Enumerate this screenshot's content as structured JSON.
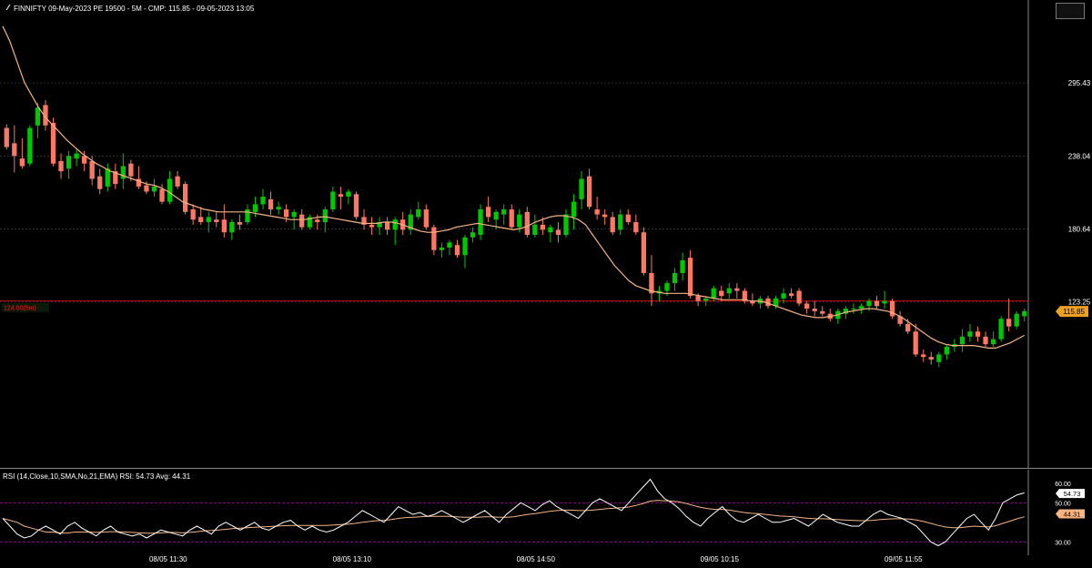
{
  "header": {
    "title": "FINNIFTY 09-May-2023 PE 19500 - 5M -  CMP: 115.85 - 09-05-2023 13:05"
  },
  "rsi_header": {
    "title": "RSI (14,Close,10,SMA,No,21,EMA) RSI: 54.73 Avg: 44.31"
  },
  "colors": {
    "bull": "#00c800",
    "bear": "#fa7864",
    "ma": "#f5b482",
    "rsi": "#ffffff",
    "rsi_avg": "#f5b482",
    "level": "#c80000",
    "band": "#c800c8",
    "cmp": "#f0a020"
  },
  "chart_data": {
    "type": "candlestick",
    "title": "FINNIFTY 09-May-2023 PE 19500 - 5M -  CMP: 115.85 - 09-05-2023 13:05",
    "price_axis": {
      "range": [
        0,
        352
      ],
      "ticks": [
        123.25,
        180.64,
        238.04,
        295.43
      ]
    },
    "cmp": {
      "value": 115.85,
      "label": "115.85"
    },
    "level": {
      "value": 124.0,
      "label": "124.00(5m)"
    },
    "time_labels": [
      {
        "label": "08/05 11:30",
        "index": 18
      },
      {
        "label": "08/05 13:10",
        "index": 38
      },
      {
        "label": "08/05 14:50",
        "index": 58
      },
      {
        "label": "09/05 10:15",
        "index": 78
      },
      {
        "label": "09/05 11:55",
        "index": 98
      }
    ],
    "candles": [
      {
        "o": 260,
        "h": 263,
        "l": 243,
        "c": 245
      },
      {
        "o": 248,
        "h": 262,
        "l": 225,
        "c": 238
      },
      {
        "o": 236,
        "h": 252,
        "l": 228,
        "c": 230
      },
      {
        "o": 232,
        "h": 262,
        "l": 230,
        "c": 260
      },
      {
        "o": 262,
        "h": 280,
        "l": 252,
        "c": 276
      },
      {
        "o": 278,
        "h": 282,
        "l": 258,
        "c": 262
      },
      {
        "o": 264,
        "h": 268,
        "l": 230,
        "c": 232
      },
      {
        "o": 234,
        "h": 240,
        "l": 220,
        "c": 226
      },
      {
        "o": 228,
        "h": 242,
        "l": 220,
        "c": 238
      },
      {
        "o": 236,
        "h": 243,
        "l": 230,
        "c": 240
      },
      {
        "o": 238,
        "h": 242,
        "l": 226,
        "c": 232
      },
      {
        "o": 234,
        "h": 238,
        "l": 215,
        "c": 220
      },
      {
        "o": 222,
        "h": 228,
        "l": 208,
        "c": 212
      },
      {
        "o": 214,
        "h": 232,
        "l": 210,
        "c": 228
      },
      {
        "o": 226,
        "h": 232,
        "l": 212,
        "c": 216
      },
      {
        "o": 220,
        "h": 240,
        "l": 212,
        "c": 230
      },
      {
        "o": 232,
        "h": 235,
        "l": 218,
        "c": 222
      },
      {
        "o": 220,
        "h": 230,
        "l": 212,
        "c": 214
      },
      {
        "o": 215,
        "h": 218,
        "l": 208,
        "c": 210
      },
      {
        "o": 210,
        "h": 220,
        "l": 206,
        "c": 214
      },
      {
        "o": 212,
        "h": 216,
        "l": 200,
        "c": 202
      },
      {
        "o": 202,
        "h": 226,
        "l": 200,
        "c": 220
      },
      {
        "o": 222,
        "h": 226,
        "l": 212,
        "c": 214
      },
      {
        "o": 216,
        "h": 218,
        "l": 192,
        "c": 194
      },
      {
        "o": 196,
        "h": 200,
        "l": 184,
        "c": 188
      },
      {
        "o": 190,
        "h": 198,
        "l": 184,
        "c": 186
      },
      {
        "o": 186,
        "h": 194,
        "l": 178,
        "c": 190
      },
      {
        "o": 188,
        "h": 194,
        "l": 182,
        "c": 186
      },
      {
        "o": 188,
        "h": 200,
        "l": 174,
        "c": 178
      },
      {
        "o": 178,
        "h": 188,
        "l": 172,
        "c": 186
      },
      {
        "o": 186,
        "h": 192,
        "l": 180,
        "c": 184
      },
      {
        "o": 186,
        "h": 200,
        "l": 184,
        "c": 196
      },
      {
        "o": 194,
        "h": 206,
        "l": 190,
        "c": 200
      },
      {
        "o": 200,
        "h": 212,
        "l": 196,
        "c": 206
      },
      {
        "o": 204,
        "h": 210,
        "l": 192,
        "c": 196
      },
      {
        "o": 196,
        "h": 202,
        "l": 192,
        "c": 198
      },
      {
        "o": 196,
        "h": 200,
        "l": 186,
        "c": 190
      },
      {
        "o": 190,
        "h": 196,
        "l": 180,
        "c": 194
      },
      {
        "o": 192,
        "h": 196,
        "l": 180,
        "c": 182
      },
      {
        "o": 182,
        "h": 192,
        "l": 180,
        "c": 190
      },
      {
        "o": 188,
        "h": 192,
        "l": 180,
        "c": 186
      },
      {
        "o": 186,
        "h": 198,
        "l": 178,
        "c": 196
      },
      {
        "o": 196,
        "h": 214,
        "l": 194,
        "c": 210
      },
      {
        "o": 208,
        "h": 214,
        "l": 196,
        "c": 206
      },
      {
        "o": 206,
        "h": 212,
        "l": 200,
        "c": 210
      },
      {
        "o": 208,
        "h": 210,
        "l": 188,
        "c": 190
      },
      {
        "o": 190,
        "h": 196,
        "l": 180,
        "c": 184
      },
      {
        "o": 184,
        "h": 190,
        "l": 176,
        "c": 182
      },
      {
        "o": 182,
        "h": 190,
        "l": 176,
        "c": 186
      },
      {
        "o": 186,
        "h": 190,
        "l": 176,
        "c": 180
      },
      {
        "o": 180,
        "h": 190,
        "l": 168,
        "c": 188
      },
      {
        "o": 188,
        "h": 194,
        "l": 176,
        "c": 180
      },
      {
        "o": 180,
        "h": 196,
        "l": 176,
        "c": 192
      },
      {
        "o": 190,
        "h": 202,
        "l": 188,
        "c": 196
      },
      {
        "o": 196,
        "h": 200,
        "l": 180,
        "c": 182
      },
      {
        "o": 182,
        "h": 184,
        "l": 160,
        "c": 164
      },
      {
        "o": 164,
        "h": 170,
        "l": 158,
        "c": 166
      },
      {
        "o": 166,
        "h": 172,
        "l": 160,
        "c": 170
      },
      {
        "o": 168,
        "h": 172,
        "l": 158,
        "c": 160
      },
      {
        "o": 160,
        "h": 176,
        "l": 150,
        "c": 174
      },
      {
        "o": 174,
        "h": 182,
        "l": 170,
        "c": 178
      },
      {
        "o": 176,
        "h": 200,
        "l": 172,
        "c": 196
      },
      {
        "o": 198,
        "h": 206,
        "l": 186,
        "c": 190
      },
      {
        "o": 188,
        "h": 196,
        "l": 180,
        "c": 194
      },
      {
        "o": 192,
        "h": 200,
        "l": 184,
        "c": 196
      },
      {
        "o": 196,
        "h": 200,
        "l": 180,
        "c": 182
      },
      {
        "o": 182,
        "h": 196,
        "l": 178,
        "c": 192
      },
      {
        "o": 194,
        "h": 198,
        "l": 174,
        "c": 176
      },
      {
        "o": 176,
        "h": 192,
        "l": 174,
        "c": 184
      },
      {
        "o": 184,
        "h": 190,
        "l": 176,
        "c": 180
      },
      {
        "o": 178,
        "h": 184,
        "l": 170,
        "c": 182
      },
      {
        "o": 180,
        "h": 186,
        "l": 170,
        "c": 176
      },
      {
        "o": 176,
        "h": 196,
        "l": 174,
        "c": 192
      },
      {
        "o": 190,
        "h": 208,
        "l": 180,
        "c": 202
      },
      {
        "o": 204,
        "h": 226,
        "l": 196,
        "c": 220
      },
      {
        "o": 222,
        "h": 228,
        "l": 196,
        "c": 198
      },
      {
        "o": 196,
        "h": 206,
        "l": 188,
        "c": 192
      },
      {
        "o": 192,
        "h": 196,
        "l": 184,
        "c": 190
      },
      {
        "o": 190,
        "h": 194,
        "l": 176,
        "c": 178
      },
      {
        "o": 180,
        "h": 196,
        "l": 176,
        "c": 192
      },
      {
        "o": 192,
        "h": 196,
        "l": 184,
        "c": 186
      },
      {
        "o": 186,
        "h": 192,
        "l": 176,
        "c": 178
      },
      {
        "o": 178,
        "h": 182,
        "l": 144,
        "c": 146
      },
      {
        "o": 146,
        "h": 160,
        "l": 120,
        "c": 130
      },
      {
        "o": 130,
        "h": 136,
        "l": 124,
        "c": 132
      },
      {
        "o": 132,
        "h": 140,
        "l": 128,
        "c": 138
      },
      {
        "o": 138,
        "h": 150,
        "l": 132,
        "c": 146
      },
      {
        "o": 146,
        "h": 162,
        "l": 140,
        "c": 156
      },
      {
        "o": 158,
        "h": 164,
        "l": 126,
        "c": 128
      },
      {
        "o": 128,
        "h": 130,
        "l": 120,
        "c": 124
      },
      {
        "o": 124,
        "h": 128,
        "l": 120,
        "c": 126
      },
      {
        "o": 126,
        "h": 136,
        "l": 124,
        "c": 134
      },
      {
        "o": 132,
        "h": 136,
        "l": 124,
        "c": 128
      },
      {
        "o": 130,
        "h": 138,
        "l": 126,
        "c": 134
      },
      {
        "o": 134,
        "h": 138,
        "l": 126,
        "c": 132
      },
      {
        "o": 132,
        "h": 134,
        "l": 122,
        "c": 124
      },
      {
        "o": 124,
        "h": 130,
        "l": 120,
        "c": 122
      },
      {
        "o": 122,
        "h": 128,
        "l": 118,
        "c": 126
      },
      {
        "o": 126,
        "h": 128,
        "l": 118,
        "c": 120
      },
      {
        "o": 120,
        "h": 128,
        "l": 118,
        "c": 126
      },
      {
        "o": 126,
        "h": 134,
        "l": 122,
        "c": 130
      },
      {
        "o": 130,
        "h": 134,
        "l": 126,
        "c": 128
      },
      {
        "o": 132,
        "h": 134,
        "l": 120,
        "c": 122
      },
      {
        "o": 122,
        "h": 124,
        "l": 114,
        "c": 118
      },
      {
        "o": 118,
        "h": 124,
        "l": 112,
        "c": 116
      },
      {
        "o": 116,
        "h": 120,
        "l": 112,
        "c": 114
      },
      {
        "o": 114,
        "h": 118,
        "l": 108,
        "c": 110
      },
      {
        "o": 110,
        "h": 118,
        "l": 106,
        "c": 116
      },
      {
        "o": 114,
        "h": 120,
        "l": 110,
        "c": 118
      },
      {
        "o": 118,
        "h": 122,
        "l": 114,
        "c": 118
      },
      {
        "o": 118,
        "h": 122,
        "l": 114,
        "c": 120
      },
      {
        "o": 120,
        "h": 126,
        "l": 116,
        "c": 124
      },
      {
        "o": 124,
        "h": 128,
        "l": 118,
        "c": 120
      },
      {
        "o": 122,
        "h": 132,
        "l": 118,
        "c": 124
      },
      {
        "o": 124,
        "h": 126,
        "l": 110,
        "c": 112
      },
      {
        "o": 112,
        "h": 116,
        "l": 104,
        "c": 106
      },
      {
        "o": 106,
        "h": 110,
        "l": 98,
        "c": 100
      },
      {
        "o": 100,
        "h": 106,
        "l": 80,
        "c": 82
      },
      {
        "o": 82,
        "h": 86,
        "l": 76,
        "c": 80
      },
      {
        "o": 80,
        "h": 84,
        "l": 74,
        "c": 78
      },
      {
        "o": 76,
        "h": 84,
        "l": 72,
        "c": 82
      },
      {
        "o": 82,
        "h": 90,
        "l": 78,
        "c": 88
      },
      {
        "o": 88,
        "h": 94,
        "l": 84,
        "c": 90
      },
      {
        "o": 90,
        "h": 102,
        "l": 84,
        "c": 96
      },
      {
        "o": 96,
        "h": 106,
        "l": 92,
        "c": 100
      },
      {
        "o": 100,
        "h": 104,
        "l": 92,
        "c": 96
      },
      {
        "o": 96,
        "h": 100,
        "l": 88,
        "c": 90
      },
      {
        "o": 90,
        "h": 100,
        "l": 88,
        "c": 94
      },
      {
        "o": 94,
        "h": 112,
        "l": 92,
        "c": 110
      },
      {
        "o": 110,
        "h": 126,
        "l": 100,
        "c": 104
      },
      {
        "o": 104,
        "h": 116,
        "l": 102,
        "c": 114
      },
      {
        "o": 112,
        "h": 118,
        "l": 108,
        "c": 116
      }
    ],
    "ma_line": [
      340,
      328,
      312,
      296,
      286,
      276,
      268,
      262,
      256,
      250,
      245,
      240,
      236,
      232,
      229,
      226,
      224,
      222,
      220,
      218,
      216,
      215,
      213,
      210,
      206,
      202,
      200,
      198,
      196,
      195,
      194,
      194,
      194,
      194,
      194,
      193,
      192,
      191,
      190,
      189,
      188,
      188,
      188,
      189,
      190,
      190,
      189,
      188,
      187,
      186,
      185,
      185,
      185,
      186,
      186,
      185,
      183,
      181,
      179,
      178,
      178,
      179,
      180,
      182,
      183,
      184,
      185,
      184,
      183,
      182,
      181,
      180,
      181,
      183,
      186,
      188,
      190,
      191,
      191,
      190,
      188,
      184,
      176,
      168,
      160,
      152,
      146,
      140,
      136,
      134,
      132,
      131,
      130,
      130,
      130,
      130,
      129,
      128,
      127,
      126,
      125,
      125,
      125,
      125,
      124,
      124,
      123,
      121,
      119,
      117,
      115,
      113,
      112,
      111,
      111,
      112,
      113,
      115,
      116,
      117,
      118,
      118,
      117,
      116,
      114,
      111,
      107,
      103,
      99,
      95,
      92,
      90,
      89,
      89,
      89,
      89,
      88,
      87,
      87,
      89,
      91,
      94,
      97
    ],
    "rsi": {
      "label": "RSI (14,Close,10,SMA,No,21,EMA)",
      "value": 54.73,
      "avg": 44.31,
      "value_label": "54.73",
      "avg_label": "44.31",
      "range": [
        25,
        65
      ],
      "ticks": [
        30.0,
        50.0,
        60.0
      ],
      "tick_labels": [
        "30.00",
        "50.00",
        "60.00"
      ],
      "bands": [
        30,
        50
      ],
      "values": [
        42,
        38,
        34,
        32,
        33,
        36,
        38,
        36,
        34,
        38,
        40,
        37,
        35,
        33,
        36,
        38,
        35,
        34,
        33,
        34,
        32,
        34,
        36,
        35,
        34,
        33,
        36,
        38,
        36,
        34,
        38,
        40,
        38,
        36,
        38,
        40,
        37,
        36,
        38,
        40,
        41,
        38,
        36,
        38,
        36,
        35,
        36,
        38,
        40,
        43,
        46,
        44,
        42,
        40,
        44,
        48,
        46,
        44,
        45,
        43,
        44,
        46,
        44,
        42,
        40,
        42,
        44,
        46,
        43,
        40,
        44,
        47,
        50,
        48,
        46,
        49,
        51,
        48,
        46,
        44,
        42,
        46,
        50,
        52,
        50,
        48,
        46,
        50,
        54,
        58,
        62,
        56,
        52,
        50,
        47,
        43,
        40,
        38,
        42,
        45,
        48,
        44,
        41,
        40,
        42,
        44,
        42,
        40,
        40,
        41,
        42,
        40,
        38,
        41,
        44,
        42,
        40,
        39,
        38,
        38,
        41,
        44,
        46,
        44,
        43,
        42,
        40,
        38,
        34,
        30,
        28,
        30,
        34,
        38,
        42,
        44,
        40,
        36,
        42,
        50,
        52,
        54,
        55
      ],
      "avg_values": [
        42,
        41,
        40,
        38,
        37,
        36,
        35,
        35,
        34.5,
        34.5,
        35,
        35,
        35,
        34.8,
        35,
        35.2,
        35.2,
        35,
        34.8,
        34.6,
        34.4,
        34.4,
        34.6,
        34.8,
        34.8,
        34.6,
        34.8,
        35.2,
        35.6,
        35.8,
        36,
        36.4,
        36.8,
        37,
        37.2,
        37.4,
        37.6,
        37.8,
        38,
        38.2,
        38.4,
        38.4,
        38.4,
        38.4,
        38.4,
        38.4,
        38.6,
        38.8,
        39,
        39.4,
        40,
        40.4,
        40.8,
        41,
        41.4,
        42,
        42.4,
        42.6,
        42.8,
        43,
        43,
        43,
        43,
        42.8,
        42.6,
        42.6,
        42.6,
        42.8,
        42.8,
        42.6,
        42.6,
        42.8,
        43.4,
        44,
        44.4,
        45,
        45.6,
        46,
        46.2,
        46.2,
        46,
        46,
        46.2,
        46.6,
        47,
        47.2,
        47.4,
        47.8,
        48.6,
        49.6,
        50.8,
        51.2,
        51,
        50.8,
        50.4,
        49.6,
        48.6,
        47.6,
        47,
        46.6,
        46.6,
        46.2,
        45.6,
        45,
        44.6,
        44.4,
        44,
        43.6,
        43.2,
        43,
        42.8,
        42.4,
        42,
        41.8,
        41.8,
        41.6,
        41.4,
        41.2,
        41,
        40.8,
        40.8,
        41,
        41.4,
        41.6,
        41.8,
        41.8,
        41.6,
        41.2,
        40.4,
        39.4,
        38.4,
        37.6,
        37.2,
        37.2,
        37.6,
        38,
        37.8,
        37.6,
        38.2,
        39.4,
        40.6,
        41.8,
        42.8
      ]
    }
  }
}
